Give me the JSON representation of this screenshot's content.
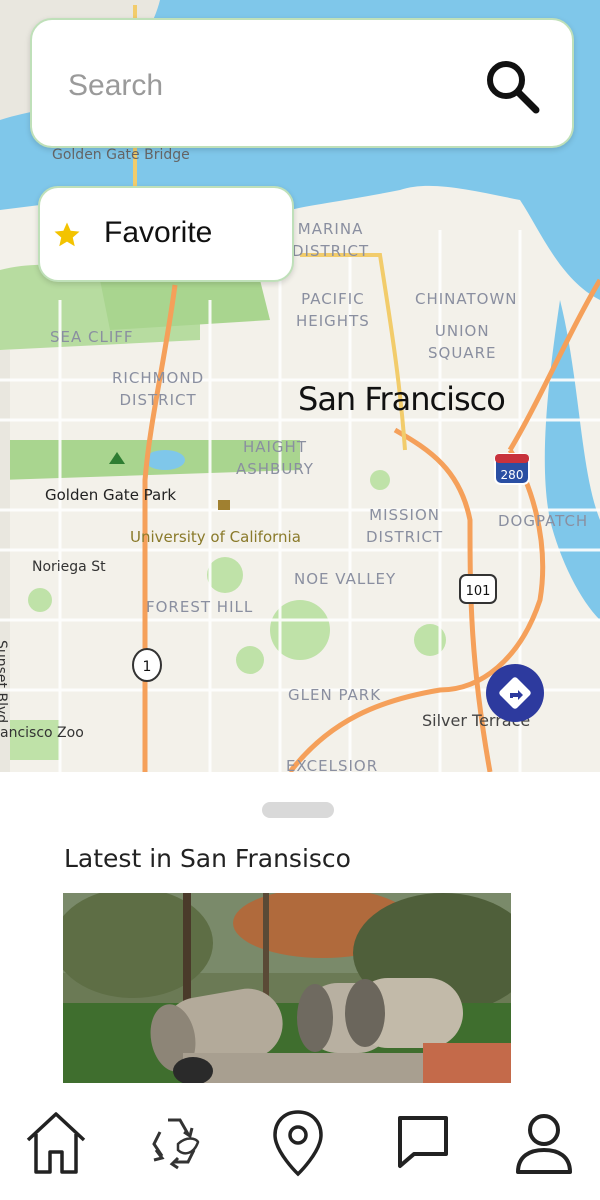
{
  "search": {
    "placeholder": "Search"
  },
  "favorite": {
    "label": "Favorite"
  },
  "map": {
    "city": "San Francisco",
    "labels": {
      "golden_gate_bridge": "Golden Gate Bridge",
      "marina": "MARINA\nDISTRICT",
      "pacific_heights": "PACIFIC\nHEIGHTS",
      "chinatown": "CHINATOWN",
      "union_square": "UNION\nSQUARE",
      "sea_cliff": "SEA CLIFF",
      "richmond": "RICHMOND\nDISTRICT",
      "haight": "HAIGHT\nASHBURY",
      "golden_gate_park": "Golden Gate Park",
      "university": "University of California",
      "mission": "MISSION\nDISTRICT",
      "dogpatch": "DOGPATCH",
      "noriega": "Noriega St",
      "sunset_blvd": "Sunset Blvd",
      "noe_valley": "NOE VALLEY",
      "forest_hill": "FOREST HILL",
      "glen_park": "GLEN PARK",
      "silver_terrace": "Silver Terrace",
      "zoo": "ancisco Zoo",
      "excelsior": "EXCELSIOR",
      "shield_280": "280",
      "shield_101": "101",
      "shield_1": "1"
    }
  },
  "sheet": {
    "title": "Latest in San Fransisco"
  },
  "nav": {
    "items": [
      {
        "icon": "home-icon"
      },
      {
        "icon": "recycle-icon"
      },
      {
        "icon": "location-pin-icon"
      },
      {
        "icon": "chat-icon"
      },
      {
        "icon": "profile-icon"
      }
    ]
  },
  "colors": {
    "water": "#7fc7ea",
    "park": "#b7dca0",
    "highway": "#f5a05a",
    "accent_border": "#bfe0b9",
    "direction_button": "#2d3a9e",
    "star": "#f3c300"
  }
}
